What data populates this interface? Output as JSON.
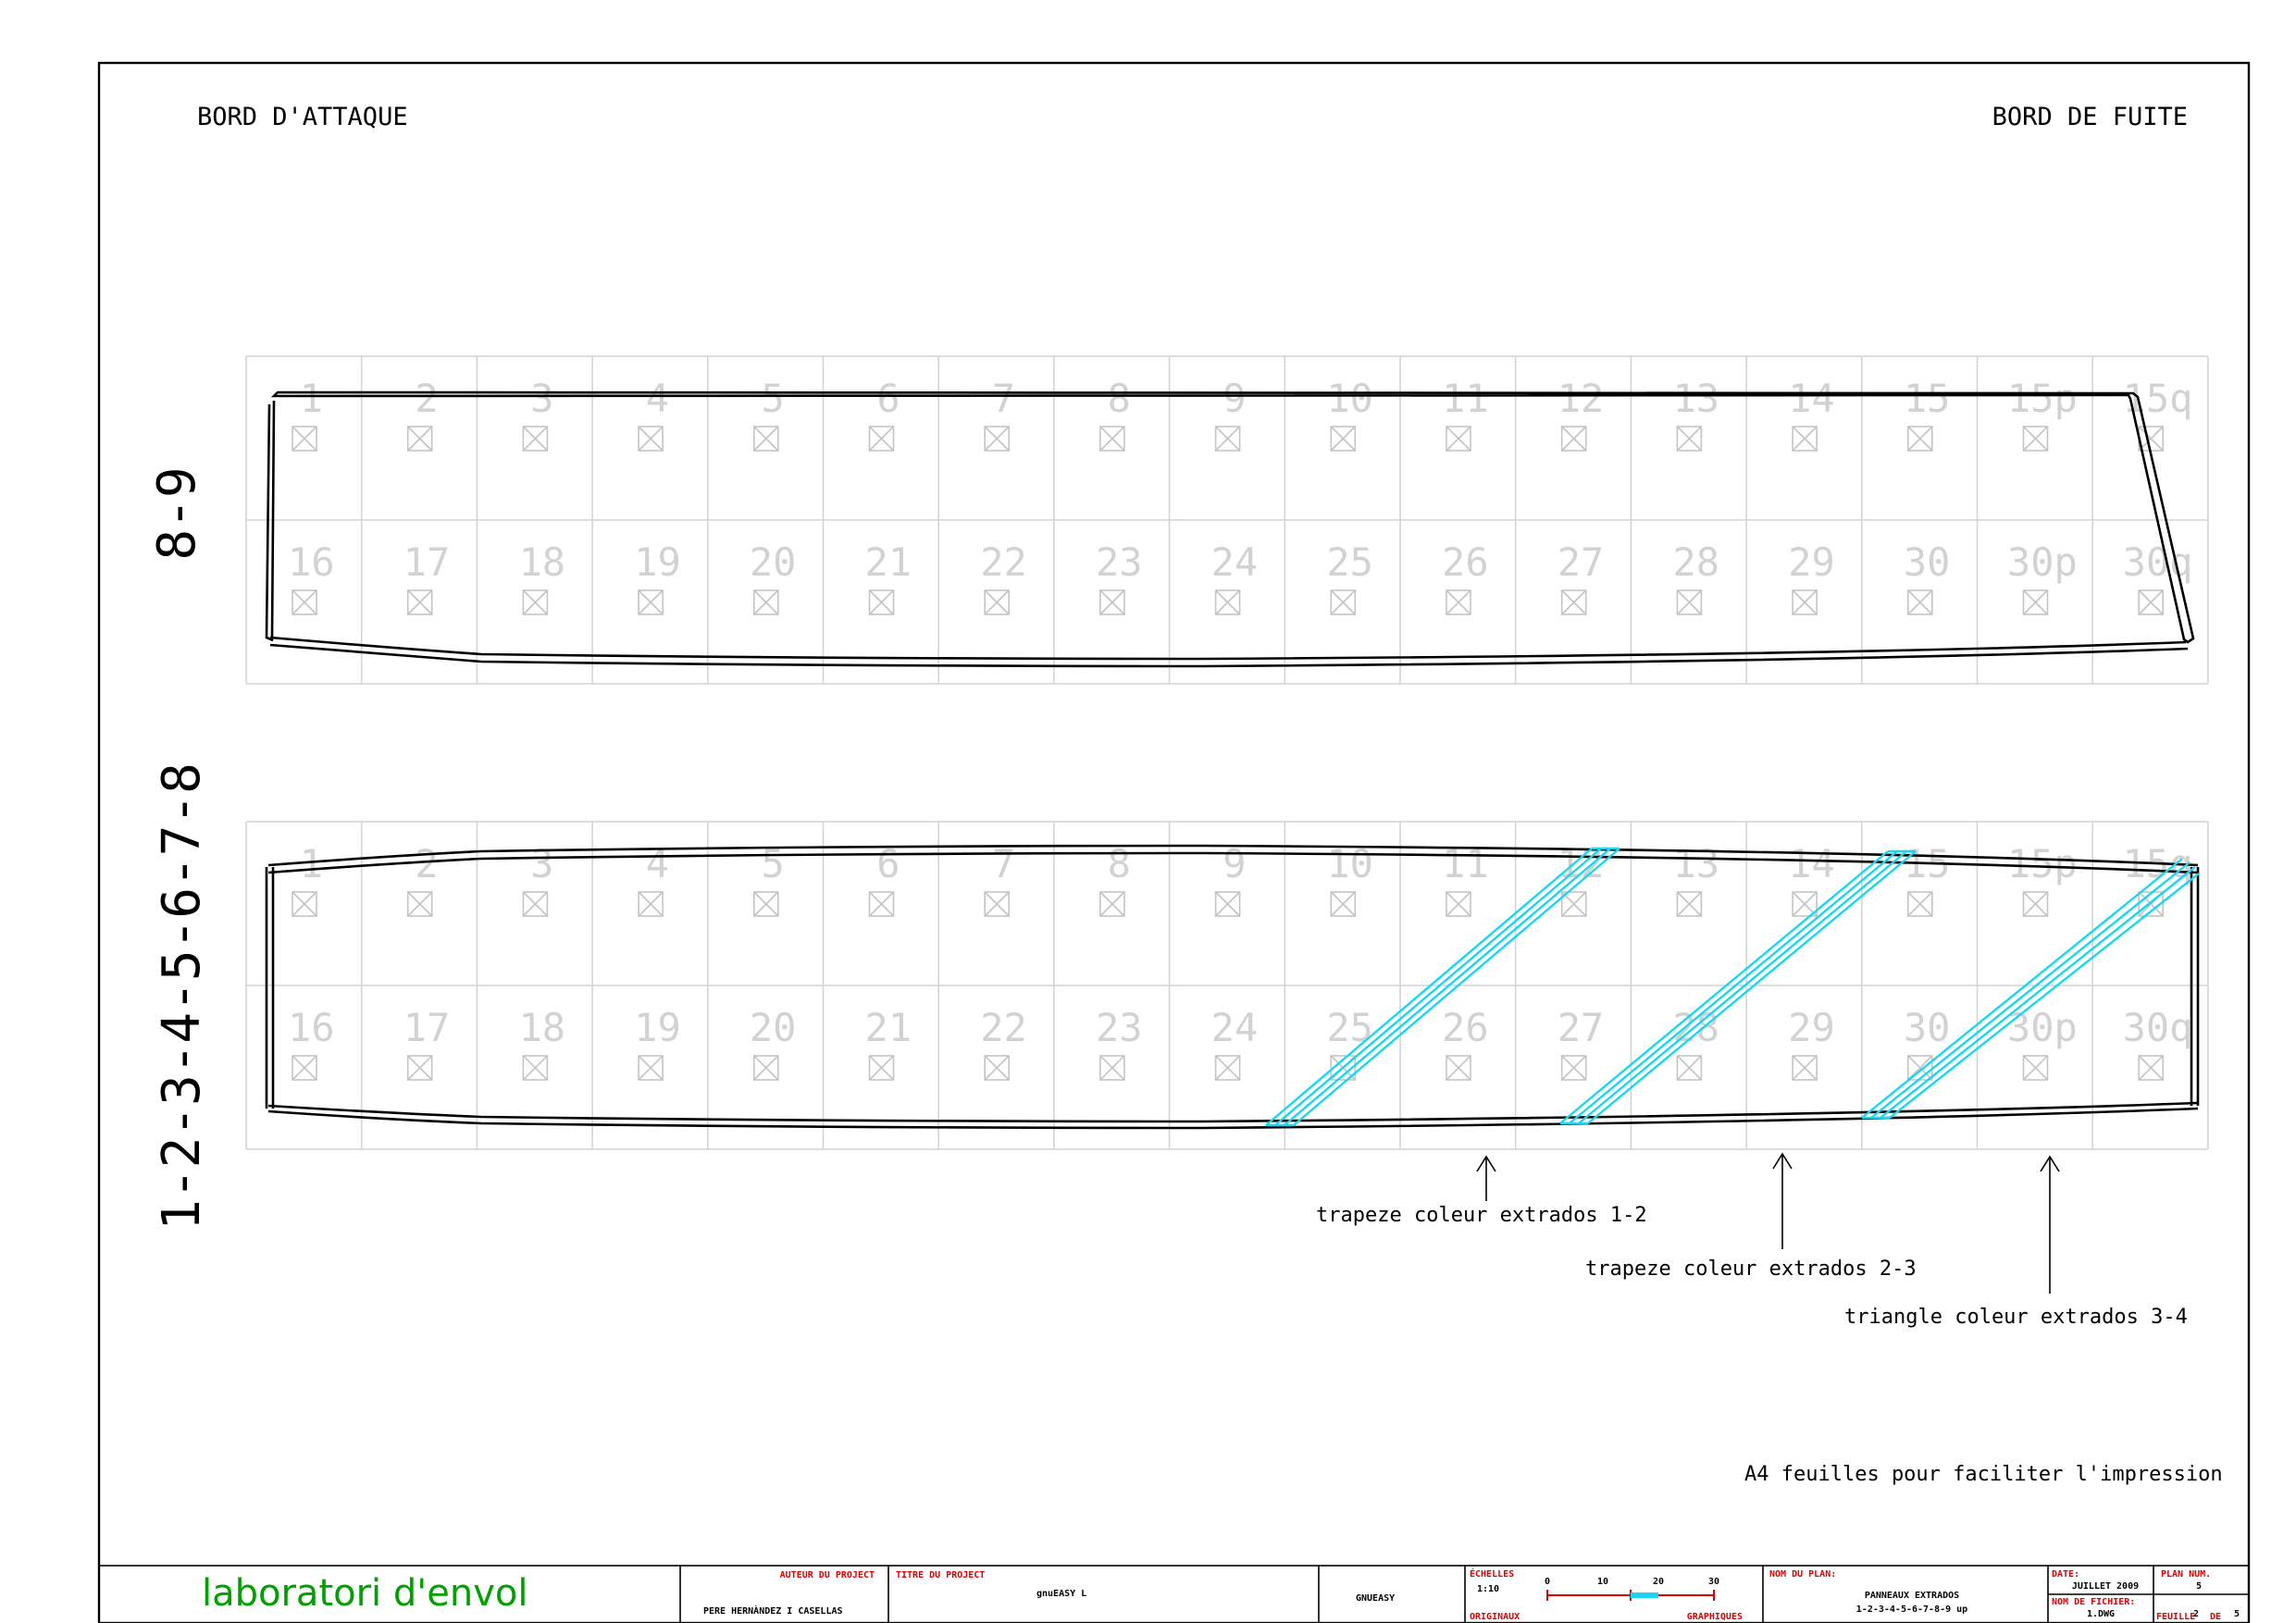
{
  "headers": {
    "leading_edge": "BORD D'ATTAQUE",
    "trailing_edge": "BORD DE FUITE"
  },
  "panels": [
    {
      "label": "8-9",
      "row1": [
        "1",
        "2",
        "3",
        "4",
        "5",
        "6",
        "7",
        "8",
        "9",
        "10",
        "11",
        "12",
        "13",
        "14",
        "15",
        "15p",
        "15q"
      ],
      "row2": [
        "16",
        "17",
        "18",
        "19",
        "20",
        "21",
        "22",
        "23",
        "24",
        "25",
        "26",
        "27",
        "28",
        "29",
        "30",
        "30p",
        "30q"
      ]
    },
    {
      "label": "1-2-3-4-5-6-7-8",
      "row1": [
        "1",
        "2",
        "3",
        "4",
        "5",
        "6",
        "7",
        "8",
        "9",
        "10",
        "11",
        "12",
        "13",
        "14",
        "15",
        "15p",
        "15q"
      ],
      "row2": [
        "16",
        "17",
        "18",
        "19",
        "20",
        "21",
        "22",
        "23",
        "24",
        "25",
        "26",
        "27",
        "28",
        "29",
        "30",
        "30p",
        "30q"
      ]
    }
  ],
  "annotations": [
    "trapeze coleur extrados 1-2",
    "trapeze coleur extrados 2-3",
    "triangle coleur extrados 3-4"
  ],
  "print_note": "A4 feuilles pour faciliter l'impression",
  "colors": {
    "stripe": "#18d8f0",
    "brand": "#00a000",
    "title_label": "#e00000"
  },
  "title_block": {
    "brand": "laboratori d'envol",
    "author_label": "AUTEUR DU PROJECT",
    "author": "PERE HERNÀNDEZ I CASELLAS",
    "title_label": "TITRE DU PROJECT",
    "title": "gnuEASY L",
    "company": "GNUEASY",
    "scales_label": "ÉCHELLES",
    "scale": "1:10",
    "originals_label": "ORIGINAUX",
    "graphics_label": "GRAPHIQUES",
    "scale_ticks": [
      "0",
      "10",
      "20",
      "30"
    ],
    "plan_name_label": "NOM DU PLAN:",
    "plan_name_line1": "PANNEAUX EXTRADOS",
    "plan_name_line2": "1-2-3-4-5-6-7-8-9 up",
    "date_label": "DATE:",
    "date": "JUILLET 2009",
    "file_label": "NOM DE FICHIER:",
    "file": "1.DWG",
    "plan_num_label": "PLAN NUM.",
    "plan_num": "5",
    "sheet_label": "FEUILLE",
    "sheet_of": "DE",
    "sheet_num": "2",
    "sheet_total": "5"
  }
}
